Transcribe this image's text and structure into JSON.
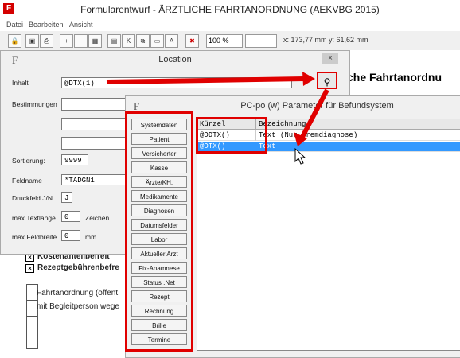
{
  "window": {
    "title": "Formularentwurf - ÄRZTLICHE FAHRTANORDNUNG (AEKVBG 2015)",
    "app_icon": "F"
  },
  "menu": [
    "Datei",
    "Bearbeiten",
    "Ansicht"
  ],
  "toolbar": {
    "zoom_value": "100 %",
    "coords": "x: 173,77 mm  y: 61,62 mm"
  },
  "document": {
    "heading_partial": "che Fahrtanordnu",
    "check1": "Kostenanteilbefreit",
    "check2": "Rezeptgebührenbefre",
    "line1": "Fahrtanordnung (öffent",
    "line2": "mit Begleitperson wege"
  },
  "location": {
    "title": "Location",
    "icon_letter": "F",
    "close": "×",
    "labels": {
      "inhalt": "Inhalt",
      "bestimmungen": "Bestimmungen",
      "sortierung": "Sortierung:",
      "feldname": "Feldname",
      "druckfeld": "Druckfeld J/N",
      "maxtext": "max.Textlänge",
      "maxbreite": "max.Feldbreite",
      "zeichen": "Zeichen",
      "mm": "mm"
    },
    "values": {
      "inhalt": "@DTX(1)",
      "sortierung": "9999",
      "feldname": "*TADGN1",
      "druckfeld": "J",
      "maxtext": "0",
      "maxbreite": "0"
    }
  },
  "pc_window": {
    "title": "PC-po (w) Parameter für Befundsystem",
    "icon_letter": "F",
    "buttons": [
      "Systemdaten",
      "Patient",
      "Versicherter",
      "Kasse",
      "Ärzte/KH.",
      "Medikamente",
      "Diagnosen",
      "Datumsfelder",
      "Labor",
      "Aktueller Arzt",
      "Fix-Anamnese",
      "Status .Net",
      "Rezept",
      "Rechnung",
      "Brille",
      "Termine"
    ],
    "columns": [
      "Kürzel",
      "Bezeichnung"
    ],
    "rows": [
      {
        "kuerzel": "@DDTX()",
        "bezeichnung": "Text (Nur Fremdiagnose)"
      },
      {
        "kuerzel": "@DTX()",
        "bezeichnung": "Text"
      }
    ]
  },
  "colors": {
    "highlight": "#e00000",
    "selection": "#3399ff"
  }
}
